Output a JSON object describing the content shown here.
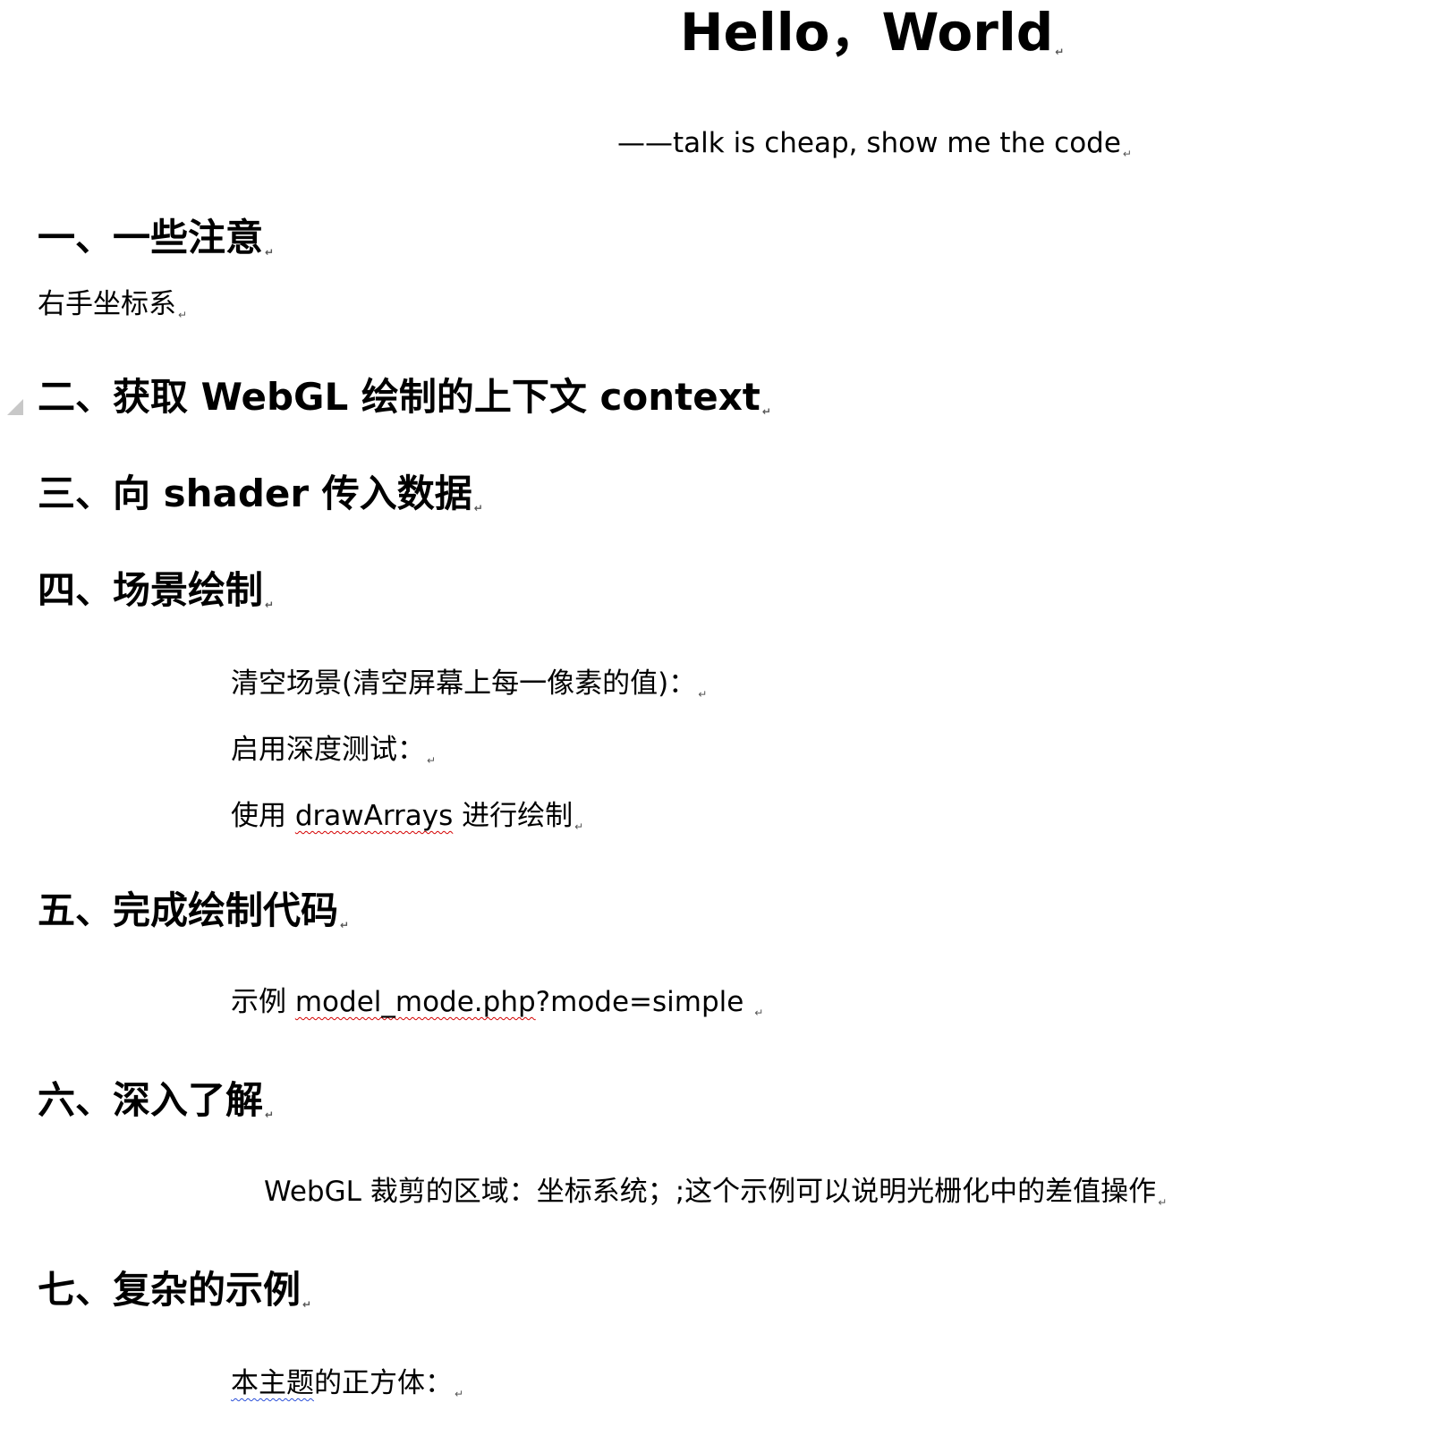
{
  "title": "Hello，World",
  "subtitle": "——talk is cheap, show me the code",
  "paragraph_mark": "↵",
  "sections": [
    {
      "heading": "一、一些注意",
      "lines": [
        "右手坐标系"
      ]
    },
    {
      "heading": "二、获取 WebGL 绘制的上下文 context"
    },
    {
      "heading": "三、向 shader 传入数据"
    },
    {
      "heading": "四、场景绘制",
      "lines": [
        "清空场景(清空屏幕上每一像素的值)：",
        "启用深度测试："
      ],
      "draw_line": {
        "prefix": "使用 ",
        "term": "drawArrays",
        "suffix": " 进行绘制"
      }
    },
    {
      "heading": "五、完成绘制代码",
      "example_line": {
        "prefix": "示例 ",
        "term": "model_mode.php",
        "suffix": "?mode=simple "
      }
    },
    {
      "heading": "六、深入了解",
      "lines": [
        "WebGL 裁剪的区域：坐标系统；;这个示例可以说明光栅化中的差值操作"
      ]
    },
    {
      "heading": "七、复杂的示例",
      "cube_line": {
        "term": "本主题",
        "suffix": "的正方体："
      }
    }
  ]
}
